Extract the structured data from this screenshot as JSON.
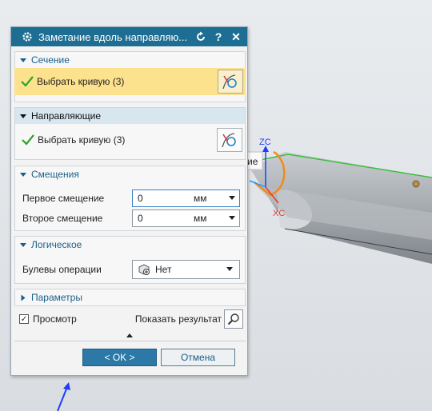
{
  "dialog": {
    "title": "Заметание вдоль направляю...",
    "icons": [
      "gear-icon",
      "reset-icon",
      "help-icon",
      "close-icon"
    ],
    "help_label": "?",
    "close_label": "✕"
  },
  "section": {
    "title": "Сечение",
    "select_label": "Выбрать кривую (3)"
  },
  "guides": {
    "title": "Направляющие",
    "select_label": "Выбрать кривую (3)"
  },
  "offsets": {
    "title": "Смещения",
    "first_label": "Первое смещение",
    "first_value": "0",
    "first_unit": "мм",
    "second_label": "Второе смещение",
    "second_value": "0",
    "second_unit": "мм"
  },
  "boolean": {
    "title": "Логическое",
    "op_label": "Булевы операции",
    "op_value": "Нет"
  },
  "params": {
    "title": "Параметры"
  },
  "preview": {
    "label": "Просмотр",
    "checked": true,
    "show_result_label": "Показать результат"
  },
  "buttons": {
    "ok": "< OK >",
    "cancel": "Отмена"
  },
  "viewport": {
    "axis_zc": "ZC",
    "axis_xc": "XC",
    "tooltip_fragment": "ие",
    "colors": {
      "axis": "#1e3cff",
      "xc": "#e83a2a",
      "guide": "#f28a1a",
      "edge": "#3cbf3c"
    }
  },
  "colors": {
    "titlebar": "#1e6d93",
    "highlight": "#fde28d",
    "ok_button": "#2c78a6"
  }
}
